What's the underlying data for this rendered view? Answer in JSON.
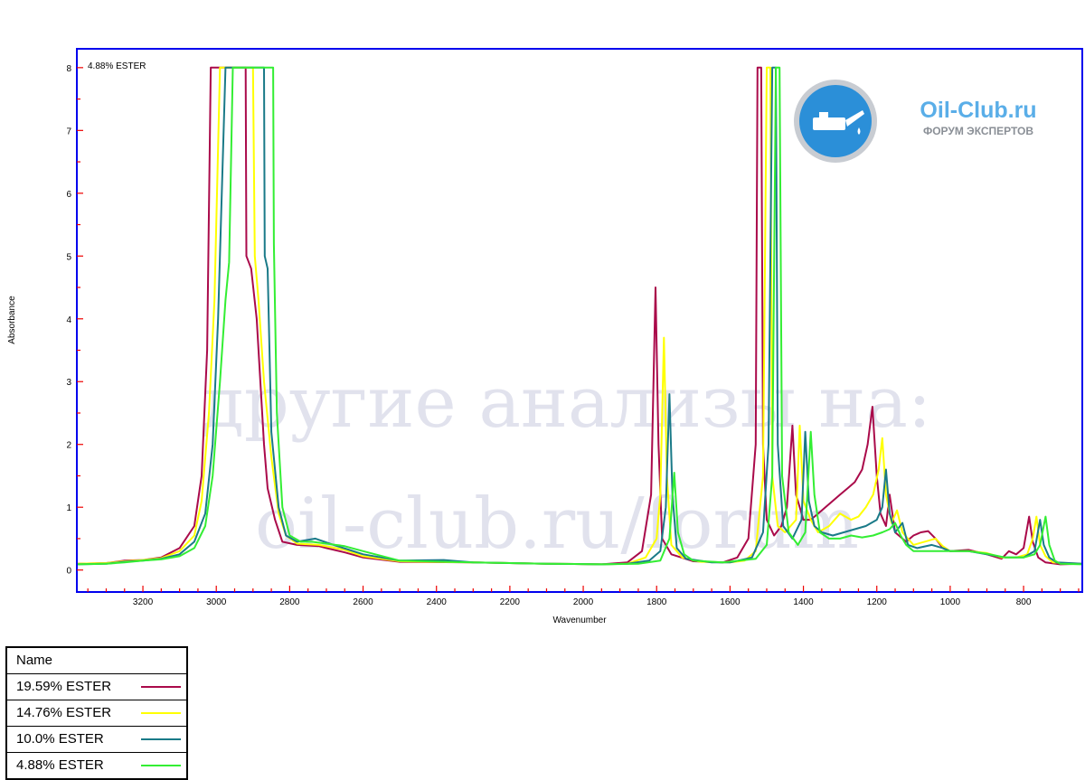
{
  "chart_data": {
    "type": "line",
    "title": "4.88% ESTER",
    "xlabel": "Wavenumber",
    "ylabel": "Absorbance",
    "xlim": [
      3380,
      640
    ],
    "ylim": [
      -0.35,
      8.3
    ],
    "x_ticks": [
      3200,
      3000,
      2800,
      2600,
      2400,
      2200,
      2000,
      1800,
      1600,
      1400,
      1200,
      1000,
      800
    ],
    "y_ticks": [
      0,
      1,
      2,
      3,
      4,
      5,
      6,
      7,
      8
    ],
    "legend_position": "bottom-left",
    "series": [
      {
        "name": "19.59% ESTER",
        "color": "#aa0a4a",
        "points": [
          [
            3380,
            0.1
          ],
          [
            3300,
            0.11
          ],
          [
            3250,
            0.15
          ],
          [
            3200,
            0.16
          ],
          [
            3150,
            0.2
          ],
          [
            3100,
            0.35
          ],
          [
            3060,
            0.7
          ],
          [
            3040,
            1.5
          ],
          [
            3025,
            3.5
          ],
          [
            3015,
            8
          ],
          [
            2920,
            8
          ],
          [
            2918,
            5
          ],
          [
            2905,
            4.8
          ],
          [
            2890,
            4
          ],
          [
            2870,
            2
          ],
          [
            2860,
            1.3
          ],
          [
            2840,
            0.8
          ],
          [
            2820,
            0.45
          ],
          [
            2780,
            0.4
          ],
          [
            2720,
            0.38
          ],
          [
            2700,
            0.35
          ],
          [
            2650,
            0.28
          ],
          [
            2600,
            0.2
          ],
          [
            2500,
            0.13
          ],
          [
            2300,
            0.12
          ],
          [
            2100,
            0.1
          ],
          [
            1950,
            0.09
          ],
          [
            1880,
            0.12
          ],
          [
            1840,
            0.3
          ],
          [
            1815,
            1.2
          ],
          [
            1803,
            4.5
          ],
          [
            1795,
            2
          ],
          [
            1785,
            0.5
          ],
          [
            1760,
            0.25
          ],
          [
            1700,
            0.14
          ],
          [
            1620,
            0.12
          ],
          [
            1580,
            0.2
          ],
          [
            1550,
            0.5
          ],
          [
            1530,
            2
          ],
          [
            1525,
            8
          ],
          [
            1515,
            8
          ],
          [
            1510,
            2
          ],
          [
            1500,
            0.8
          ],
          [
            1480,
            0.55
          ],
          [
            1460,
            0.7
          ],
          [
            1445,
            1
          ],
          [
            1430,
            2.3
          ],
          [
            1420,
            1.2
          ],
          [
            1400,
            0.8
          ],
          [
            1380,
            0.8
          ],
          [
            1360,
            0.9
          ],
          [
            1340,
            1
          ],
          [
            1320,
            1.1
          ],
          [
            1300,
            1.2
          ],
          [
            1280,
            1.3
          ],
          [
            1260,
            1.4
          ],
          [
            1240,
            1.6
          ],
          [
            1225,
            2
          ],
          [
            1212,
            2.6
          ],
          [
            1200,
            1.5
          ],
          [
            1190,
            0.9
          ],
          [
            1175,
            0.7
          ],
          [
            1165,
            1.2
          ],
          [
            1150,
            0.6
          ],
          [
            1120,
            0.45
          ],
          [
            1100,
            0.55
          ],
          [
            1080,
            0.6
          ],
          [
            1060,
            0.62
          ],
          [
            1040,
            0.5
          ],
          [
            1020,
            0.35
          ],
          [
            1000,
            0.3
          ],
          [
            950,
            0.32
          ],
          [
            900,
            0.25
          ],
          [
            860,
            0.18
          ],
          [
            840,
            0.3
          ],
          [
            820,
            0.25
          ],
          [
            800,
            0.35
          ],
          [
            785,
            0.85
          ],
          [
            775,
            0.45
          ],
          [
            760,
            0.2
          ],
          [
            740,
            0.12
          ],
          [
            700,
            0.09
          ],
          [
            640,
            0.1
          ]
        ]
      },
      {
        "name": "14.76% ESTER",
        "color": "#ffff00",
        "points": [
          [
            3380,
            0.1
          ],
          [
            3300,
            0.11
          ],
          [
            3250,
            0.14
          ],
          [
            3200,
            0.16
          ],
          [
            3150,
            0.19
          ],
          [
            3100,
            0.3
          ],
          [
            3060,
            0.55
          ],
          [
            3040,
            1.1
          ],
          [
            3020,
            2.5
          ],
          [
            3005,
            4.3
          ],
          [
            2990,
            8
          ],
          [
            2900,
            8
          ],
          [
            2895,
            5
          ],
          [
            2885,
            4.3
          ],
          [
            2870,
            3
          ],
          [
            2850,
            1.8
          ],
          [
            2830,
            0.9
          ],
          [
            2810,
            0.55
          ],
          [
            2780,
            0.42
          ],
          [
            2720,
            0.4
          ],
          [
            2650,
            0.32
          ],
          [
            2600,
            0.22
          ],
          [
            2500,
            0.14
          ],
          [
            2300,
            0.12
          ],
          [
            2100,
            0.1
          ],
          [
            1950,
            0.09
          ],
          [
            1880,
            0.1
          ],
          [
            1830,
            0.2
          ],
          [
            1800,
            0.5
          ],
          [
            1790,
            1.2
          ],
          [
            1780,
            3.7
          ],
          [
            1772,
            1.5
          ],
          [
            1760,
            0.4
          ],
          [
            1730,
            0.2
          ],
          [
            1680,
            0.13
          ],
          [
            1600,
            0.12
          ],
          [
            1560,
            0.15
          ],
          [
            1530,
            0.3
          ],
          [
            1510,
            1.5
          ],
          [
            1500,
            8
          ],
          [
            1490,
            8
          ],
          [
            1485,
            1.5
          ],
          [
            1470,
            0.7
          ],
          [
            1450,
            0.6
          ],
          [
            1420,
            0.8
          ],
          [
            1410,
            2.3
          ],
          [
            1400,
            1.1
          ],
          [
            1380,
            0.8
          ],
          [
            1360,
            0.6
          ],
          [
            1330,
            0.7
          ],
          [
            1300,
            0.9
          ],
          [
            1270,
            0.8
          ],
          [
            1250,
            0.85
          ],
          [
            1230,
            1
          ],
          [
            1210,
            1.2
          ],
          [
            1195,
            1.6
          ],
          [
            1185,
            2.1
          ],
          [
            1175,
            1.2
          ],
          [
            1160,
            0.75
          ],
          [
            1145,
            0.95
          ],
          [
            1130,
            0.6
          ],
          [
            1100,
            0.4
          ],
          [
            1070,
            0.45
          ],
          [
            1040,
            0.5
          ],
          [
            1020,
            0.38
          ],
          [
            1000,
            0.3
          ],
          [
            950,
            0.3
          ],
          [
            900,
            0.27
          ],
          [
            860,
            0.2
          ],
          [
            820,
            0.2
          ],
          [
            790,
            0.25
          ],
          [
            775,
            0.5
          ],
          [
            765,
            0.85
          ],
          [
            755,
            0.4
          ],
          [
            740,
            0.22
          ],
          [
            720,
            0.12
          ],
          [
            640,
            0.1
          ]
        ]
      },
      {
        "name": "10.0% ESTER",
        "color": "#1a7a88",
        "points": [
          [
            3380,
            0.09
          ],
          [
            3300,
            0.1
          ],
          [
            3250,
            0.13
          ],
          [
            3200,
            0.15
          ],
          [
            3150,
            0.18
          ],
          [
            3100,
            0.25
          ],
          [
            3060,
            0.45
          ],
          [
            3030,
            0.9
          ],
          [
            3010,
            2
          ],
          [
            2995,
            4
          ],
          [
            2975,
            8
          ],
          [
            2870,
            8
          ],
          [
            2868,
            5
          ],
          [
            2860,
            4.8
          ],
          [
            2850,
            2.2
          ],
          [
            2830,
            1
          ],
          [
            2810,
            0.55
          ],
          [
            2780,
            0.45
          ],
          [
            2730,
            0.5
          ],
          [
            2680,
            0.4
          ],
          [
            2600,
            0.25
          ],
          [
            2500,
            0.15
          ],
          [
            2380,
            0.16
          ],
          [
            2300,
            0.12
          ],
          [
            2100,
            0.1
          ],
          [
            1950,
            0.09
          ],
          [
            1880,
            0.1
          ],
          [
            1820,
            0.15
          ],
          [
            1790,
            0.3
          ],
          [
            1775,
            1
          ],
          [
            1765,
            2.8
          ],
          [
            1757,
            1.2
          ],
          [
            1745,
            0.35
          ],
          [
            1720,
            0.18
          ],
          [
            1650,
            0.12
          ],
          [
            1600,
            0.12
          ],
          [
            1540,
            0.2
          ],
          [
            1510,
            0.6
          ],
          [
            1495,
            2
          ],
          [
            1485,
            8
          ],
          [
            1475,
            8
          ],
          [
            1470,
            2
          ],
          [
            1455,
            0.7
          ],
          [
            1430,
            0.5
          ],
          [
            1405,
            0.8
          ],
          [
            1395,
            2.2
          ],
          [
            1385,
            1.1
          ],
          [
            1370,
            0.7
          ],
          [
            1350,
            0.6
          ],
          [
            1320,
            0.55
          ],
          [
            1290,
            0.6
          ],
          [
            1260,
            0.65
          ],
          [
            1230,
            0.7
          ],
          [
            1200,
            0.8
          ],
          [
            1185,
            1
          ],
          [
            1175,
            1.6
          ],
          [
            1165,
            0.9
          ],
          [
            1150,
            0.6
          ],
          [
            1130,
            0.75
          ],
          [
            1115,
            0.4
          ],
          [
            1090,
            0.35
          ],
          [
            1050,
            0.4
          ],
          [
            1020,
            0.35
          ],
          [
            1000,
            0.3
          ],
          [
            950,
            0.3
          ],
          [
            900,
            0.25
          ],
          [
            850,
            0.2
          ],
          [
            800,
            0.2
          ],
          [
            770,
            0.3
          ],
          [
            755,
            0.8
          ],
          [
            745,
            0.4
          ],
          [
            730,
            0.2
          ],
          [
            710,
            0.12
          ],
          [
            640,
            0.1
          ]
        ]
      },
      {
        "name": "4.88% ESTER",
        "color": "#33ee33",
        "points": [
          [
            3380,
            0.09
          ],
          [
            3300,
            0.1
          ],
          [
            3250,
            0.12
          ],
          [
            3200,
            0.15
          ],
          [
            3150,
            0.17
          ],
          [
            3100,
            0.22
          ],
          [
            3060,
            0.35
          ],
          [
            3030,
            0.7
          ],
          [
            3010,
            1.5
          ],
          [
            2990,
            3
          ],
          [
            2975,
            4.3
          ],
          [
            2965,
            4.9
          ],
          [
            2955,
            8
          ],
          [
            2845,
            8
          ],
          [
            2843,
            5.2
          ],
          [
            2835,
            2.5
          ],
          [
            2820,
            1
          ],
          [
            2800,
            0.55
          ],
          [
            2770,
            0.45
          ],
          [
            2740,
            0.45
          ],
          [
            2700,
            0.42
          ],
          [
            2650,
            0.38
          ],
          [
            2600,
            0.3
          ],
          [
            2500,
            0.15
          ],
          [
            2300,
            0.12
          ],
          [
            2100,
            0.1
          ],
          [
            1950,
            0.09
          ],
          [
            1850,
            0.1
          ],
          [
            1790,
            0.15
          ],
          [
            1765,
            0.5
          ],
          [
            1752,
            1.55
          ],
          [
            1742,
            0.6
          ],
          [
            1725,
            0.25
          ],
          [
            1700,
            0.15
          ],
          [
            1620,
            0.12
          ],
          [
            1530,
            0.18
          ],
          [
            1500,
            0.4
          ],
          [
            1485,
            1.5
          ],
          [
            1475,
            8
          ],
          [
            1465,
            8
          ],
          [
            1458,
            1.5
          ],
          [
            1440,
            0.6
          ],
          [
            1415,
            0.4
          ],
          [
            1395,
            0.6
          ],
          [
            1380,
            2.2
          ],
          [
            1370,
            1.2
          ],
          [
            1355,
            0.6
          ],
          [
            1330,
            0.5
          ],
          [
            1300,
            0.5
          ],
          [
            1270,
            0.55
          ],
          [
            1240,
            0.52
          ],
          [
            1210,
            0.55
          ],
          [
            1185,
            0.6
          ],
          [
            1165,
            0.65
          ],
          [
            1150,
            0.75
          ],
          [
            1135,
            0.55
          ],
          [
            1120,
            0.4
          ],
          [
            1100,
            0.3
          ],
          [
            1050,
            0.3
          ],
          [
            1000,
            0.3
          ],
          [
            950,
            0.3
          ],
          [
            900,
            0.26
          ],
          [
            850,
            0.2
          ],
          [
            800,
            0.2
          ],
          [
            770,
            0.25
          ],
          [
            755,
            0.4
          ],
          [
            740,
            0.85
          ],
          [
            730,
            0.4
          ],
          [
            715,
            0.15
          ],
          [
            700,
            0.1
          ],
          [
            640,
            0.09
          ]
        ]
      }
    ]
  },
  "logo": {
    "brand": "Oil-Club.ru",
    "tagline": "ФОРУМ ЭКСПЕРТОВ",
    "icon": "oil-can-icon",
    "accent": "#2b8fd8"
  },
  "watermark": {
    "line1": "другие анализы на:",
    "line2": "oil-club.ru/forum"
  },
  "legend": {
    "header": "Name"
  },
  "colors": {
    "frame": "#0000ee",
    "tick": "#ee0000"
  }
}
